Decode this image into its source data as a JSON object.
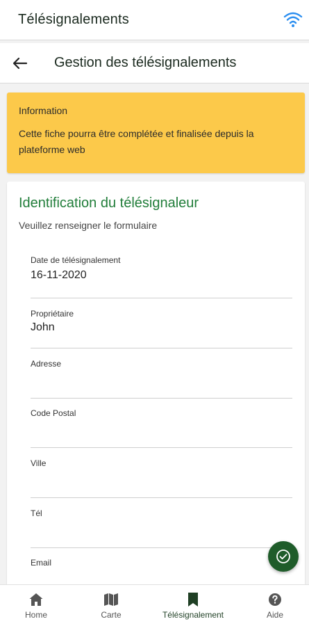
{
  "appbar": {
    "title": "Télésignalements",
    "wifi_icon": "wifi-icon"
  },
  "subbar": {
    "back_icon": "arrow-left-icon",
    "title": "Gestion des télésignalements"
  },
  "info": {
    "heading": "Information",
    "text": "Cette fiche pourra être complétée et finalisée depuis la plateforme web"
  },
  "card": {
    "title": "Identification du télésignaleur",
    "subtitle": "Veuillez renseigner le formulaire",
    "fields": [
      {
        "label": "Date de télésignalement",
        "value": "16-11-2020"
      },
      {
        "label": "Propriétaire",
        "value": "John"
      },
      {
        "label": "Adresse",
        "value": ""
      },
      {
        "label": "Code Postal",
        "value": ""
      },
      {
        "label": "Ville",
        "value": ""
      },
      {
        "label": "Tél",
        "value": ""
      },
      {
        "label": "Email",
        "value": ""
      }
    ]
  },
  "fab": {
    "icon": "check-circle-icon"
  },
  "nav": {
    "items": [
      {
        "label": "Home",
        "icon": "home-icon"
      },
      {
        "label": "Carte",
        "icon": "map-icon"
      },
      {
        "label": "Télésignalement",
        "icon": "bookmark-icon",
        "active": true
      },
      {
        "label": "Aide",
        "icon": "help-icon"
      }
    ]
  },
  "colors": {
    "accent_green": "#207d39",
    "fab_green": "#1f5c2a",
    "info_yellow": "#fcc94a",
    "wifi_blue": "#2b8ef0"
  }
}
